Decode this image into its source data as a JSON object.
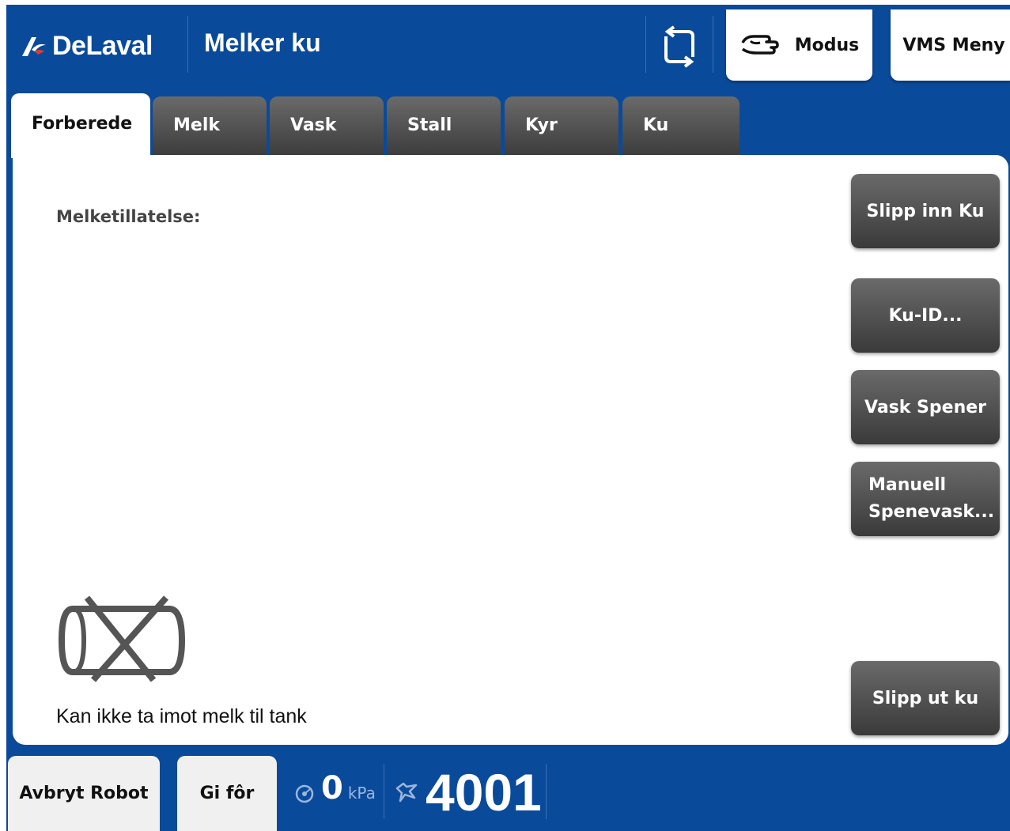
{
  "header": {
    "brand": "DeLaval",
    "title": "Melker ku",
    "modus_label": "Modus",
    "vms_menu_label": "VMS Meny"
  },
  "tabs": [
    {
      "label": "Forberede",
      "active": true
    },
    {
      "label": "Melk",
      "active": false
    },
    {
      "label": "Vask",
      "active": false
    },
    {
      "label": "Stall",
      "active": false
    },
    {
      "label": "Kyr",
      "active": false
    },
    {
      "label": "Ku",
      "active": false
    }
  ],
  "main": {
    "milk_permission_label": "Melketillatelse:",
    "tank_status": "Kan ikke ta imot melk til tank",
    "side_buttons": {
      "let_in_cow": "Slipp inn Ku",
      "cow_id": "Ku-ID...",
      "wash_teats": "Vask Spener",
      "manual_teat_wash_line1": "Manuell",
      "manual_teat_wash_line2": "Spenevask...",
      "let_out_cow": "Slipp ut ku"
    }
  },
  "footer": {
    "abort_robot": "Avbryt Robot",
    "feed": "Gi fôr",
    "pressure_value": "0",
    "pressure_unit": "kPa",
    "cow_number": "4001"
  },
  "icons": [
    "delaval-logo-icon",
    "sync-icon",
    "hand-icon",
    "tank-disabled-icon",
    "vacuum-gauge-icon",
    "cow-icon"
  ],
  "colors": {
    "header_blue": "#0a4a9a",
    "tab_dark": "#4a4a4a",
    "button_dark": "#4a4a4a",
    "panel_white": "#ffffff"
  }
}
